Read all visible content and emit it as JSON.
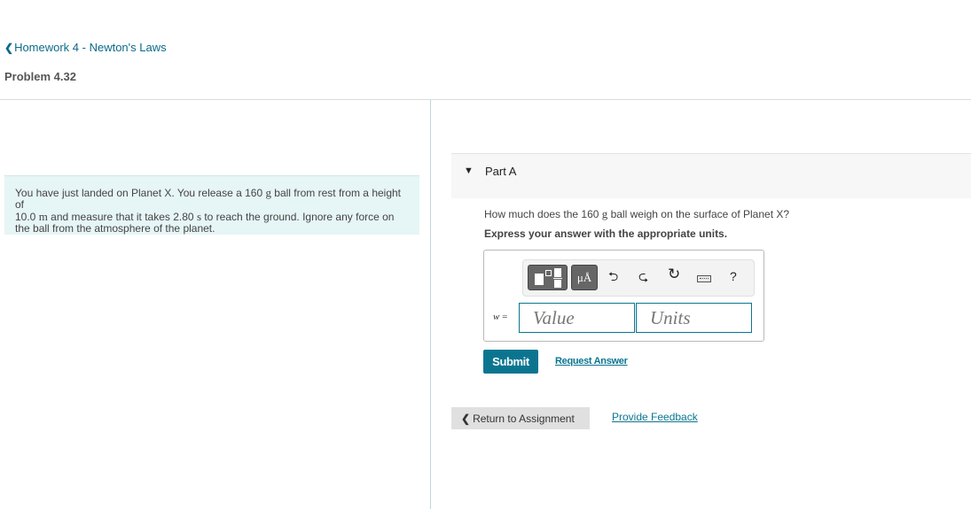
{
  "breadcrumb": {
    "back_icon": "chevron-left-icon",
    "label": "Homework 4 - Newton's Laws"
  },
  "problem": {
    "title": "Problem 4.32",
    "statement": {
      "t1": "You have just landed on Planet X. You release a 160 ",
      "u1": "g",
      "t2": " ball from rest from a height of ",
      "t3": "10.0 ",
      "u2": "m",
      "t4": " and measure that it takes 2.80 ",
      "u3": "s",
      "t5": " to reach the ground. Ignore any force on the ball from the atmosphere of the planet."
    }
  },
  "part": {
    "caret_icon": "caret-down-icon",
    "label": "Part A",
    "question": {
      "t1": "How much does the 160 ",
      "u1": "g",
      "t2": " ball weigh on the surface of Planet X?"
    },
    "instruction": "Express your answer with the appropriate units."
  },
  "toolbar": {
    "templates_icon": "templates-icon",
    "units_label": "μÅ",
    "undo_icon": "undo-icon",
    "redo_icon": "redo-icon",
    "reset_icon": "reset-icon",
    "keyboard_icon": "keyboard-icon",
    "help_label": "?"
  },
  "answer": {
    "variable": "w",
    "equals": " =",
    "value_placeholder": "Value",
    "units_placeholder": "Units"
  },
  "actions": {
    "submit_label": "Submit",
    "request_answer_label": "Request Answer"
  },
  "footer": {
    "return_label": "Return to Assignment",
    "feedback_label": "Provide Feedback"
  },
  "colors": {
    "accent": "#0b7590",
    "link": "#0b6a89",
    "problem_bg": "#e6f5f6"
  }
}
